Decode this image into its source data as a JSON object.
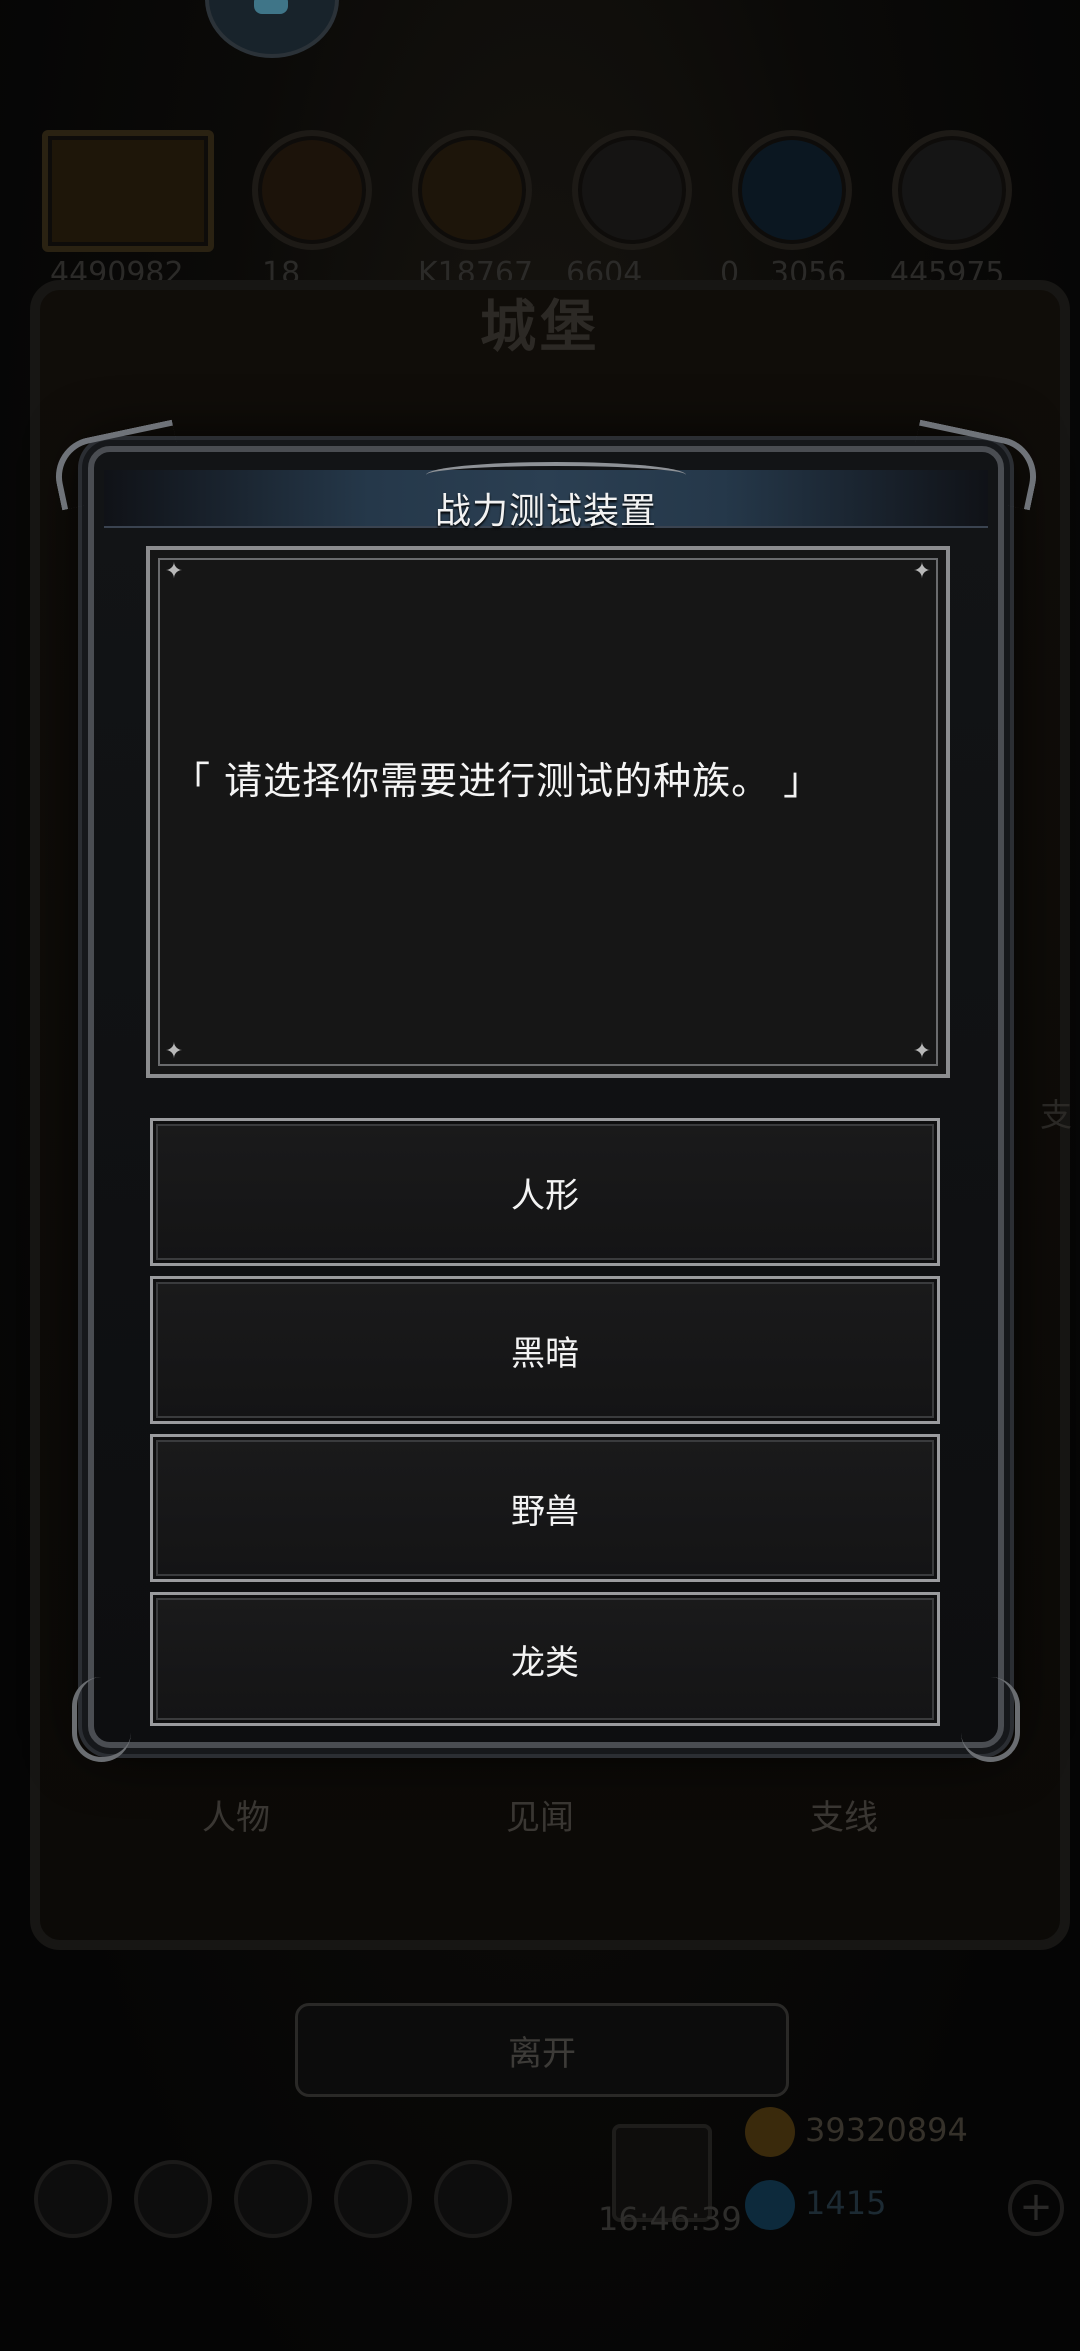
{
  "background": {
    "hero_values": [
      "4490982",
      "18",
      "K18767",
      "6604",
      "0",
      "3056",
      "445975"
    ],
    "castle_title": "城堡",
    "tabs": [
      "人物",
      "见闻",
      "支线"
    ],
    "side_label": "支",
    "leave_label": "离开",
    "clock": "16:46:39",
    "gold": "39320894",
    "gems": "1415"
  },
  "modal": {
    "title": "战力测试装置",
    "message": "「 请选择你需要进行测试的种族。 」",
    "options": [
      "人形",
      "黑暗",
      "野兽",
      "龙类"
    ]
  },
  "icons": {
    "corner_star": "✦",
    "plus": "+"
  },
  "colors": {
    "modal_border": "#4a4d52",
    "header_accent": "#2b3f52",
    "option_border": "#9a9b9e",
    "text": "#f3f3f3"
  }
}
